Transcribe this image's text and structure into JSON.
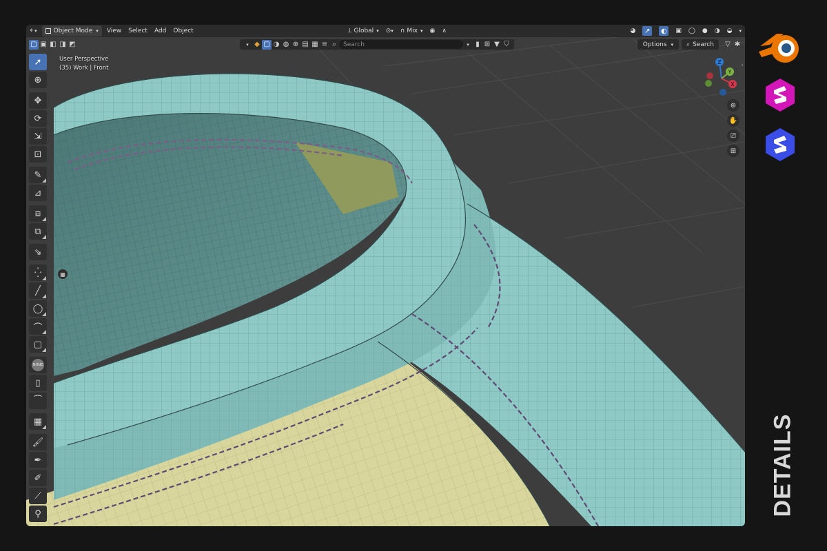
{
  "header": {
    "mode_label": "Object Mode",
    "menu": [
      "View",
      "Select",
      "Add",
      "Object"
    ],
    "transform_orientation": "Global",
    "pivot_label": "Mix"
  },
  "toolbar2": {
    "search_placeholder": "Search",
    "options_label": "Options",
    "search_button_label": "Search"
  },
  "viewport": {
    "view_name": "User Perspective",
    "collection_label": "(35) Work | Front",
    "gizmo_axes": [
      "Z",
      "Y",
      "X"
    ]
  },
  "tools": [
    "select-box",
    "cursor",
    "move",
    "rotate",
    "scale",
    "transform",
    "annotate",
    "measure",
    "add-cube",
    "extrude",
    "shear",
    "add-vertex",
    "add-edge",
    "add-circle",
    "add-arc",
    "add-plane",
    "none-material",
    "cage",
    "rip",
    "mesh-grid",
    "vertex-paint",
    "weight-paint",
    "sample",
    "knife",
    "pivot"
  ],
  "tools_none_label": "NONE",
  "side_panel": {
    "label": "DETAILS"
  },
  "colors": {
    "accent": "#4772b3",
    "brand_orange": "#ea7600",
    "brand_pink": "#d316b8",
    "brand_blue": "#3a4de6",
    "mesh_teal": "#8fc9c6",
    "mesh_yellow": "#d8d69c"
  }
}
